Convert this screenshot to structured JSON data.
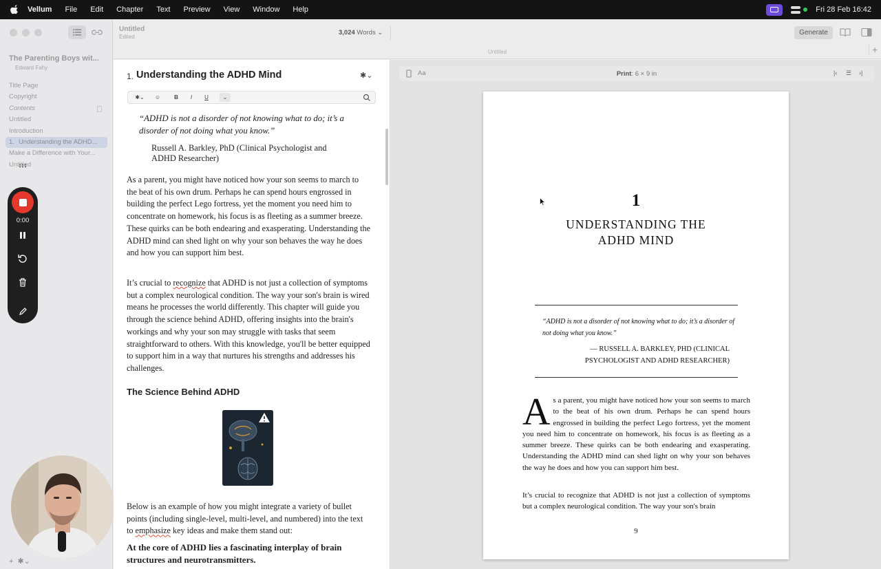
{
  "menubar": {
    "app_name": "Vellum",
    "items": [
      "File",
      "Edit",
      "Chapter",
      "Text",
      "Preview",
      "View",
      "Window",
      "Help"
    ],
    "datetime": "Fri 28 Feb  16:42"
  },
  "sidebar": {
    "book_title": "The Parenting Boys wit...",
    "author": "Edward Fahy",
    "items": [
      {
        "label": "Title Page"
      },
      {
        "label": "Copyright"
      },
      {
        "label": "Contents"
      },
      {
        "label": "Untitled"
      },
      {
        "label": "Introduction"
      },
      {
        "num": "1.",
        "label": "Understanding the ADHD..."
      },
      {
        "label": "Make a Difference with Your..."
      },
      {
        "label": "Untitled"
      }
    ]
  },
  "recorder": {
    "time": "0:00"
  },
  "header": {
    "doc_title": "Untitled",
    "doc_status": "Edited",
    "word_count": "3,024",
    "words_label": "Words",
    "generate": "Generate",
    "tab_name": "Untitled",
    "plus": "+"
  },
  "editor": {
    "chapter_num": "1.",
    "chapter_title": "Understanding the ADHD Mind",
    "fmt": {
      "bold": "B",
      "italic": "I",
      "underline": "U"
    },
    "quote": "“ADHD is not a disorder of not knowing what to do; it’s a disorder of not doing what you know.”",
    "attribution": "Russell A. Barkley, PhD (Clinical Psychologist and ADHD Researcher)",
    "para1": "As a parent, you might have noticed how your son seems to march to the beat of his own drum. Perhaps he can spend hours engrossed in building the perfect Lego fortress, yet the moment you need him to concentrate on homework, his focus is as fleeting as a summer breeze. These quirks can be both endearing and exasperating. Understanding the ADHD mind can shed light on why your son behaves the way he does and how you can support him best.",
    "para2_a": "It’s crucial to ",
    "para2_word": "recognize",
    "para2_b": " that ADHD is not just a collection of symptoms but a complex neurological condition. The way your son's brain is wired means he processes the world differently. This chapter will guide you through the science behind ADHD, offering insights into the brain's workings and why your son may struggle with tasks that seem straightforward to others. With this knowledge, you'll be better equipped to support him in a way that nurtures his strengths and addresses his challenges.",
    "subheading": "The Science Behind ADHD",
    "para3_a": "Below is an example of how you might integrate a variety of bullet points (including single-level, multi-level, and numbered) into the text to ",
    "para3_word": "emphasize",
    "para3_b": " key ideas and make them stand out:",
    "bold_para": "At the core of ADHD lies a fascinating interplay of brain structures and neurotransmitters."
  },
  "preview": {
    "aa": "Aa",
    "print_label": "Print",
    "print_size": ": 6 × 9 in",
    "page": {
      "chapter_num": "1",
      "title_line1": "UNDERSTANDING THE",
      "title_line2": "ADHD MIND",
      "quote": "“ADHD is not a disorder of not knowing what to do; it’s a disorder of not doing what you know.”",
      "attribution": "— RUSSELL A. BARKLEY, PHD (CLINICAL PSYCHOLOGIST AND ADHD RESEARCHER)",
      "dropcap": "A",
      "body1": "s a parent, you might have noticed how your son seems to march to the beat of his own drum. Perhaps he can spend hours engrossed in building the perfect Lego fortress, yet the moment you need him to concentrate on homework, his focus is as fleeting as a summer breeze. These quirks can be both endearing and exasperating. Understanding the ADHD mind can shed light on why your son behaves the way he does and how you can support him best.",
      "body2": "It’s crucial to recognize that ADHD is not just a collection of symp­toms but a complex neurological condition. The way your son's brain",
      "folio": "9"
    }
  },
  "colors": {
    "record": "#e5382d",
    "selection": "#cdd5e4",
    "menubar": "#141414"
  }
}
